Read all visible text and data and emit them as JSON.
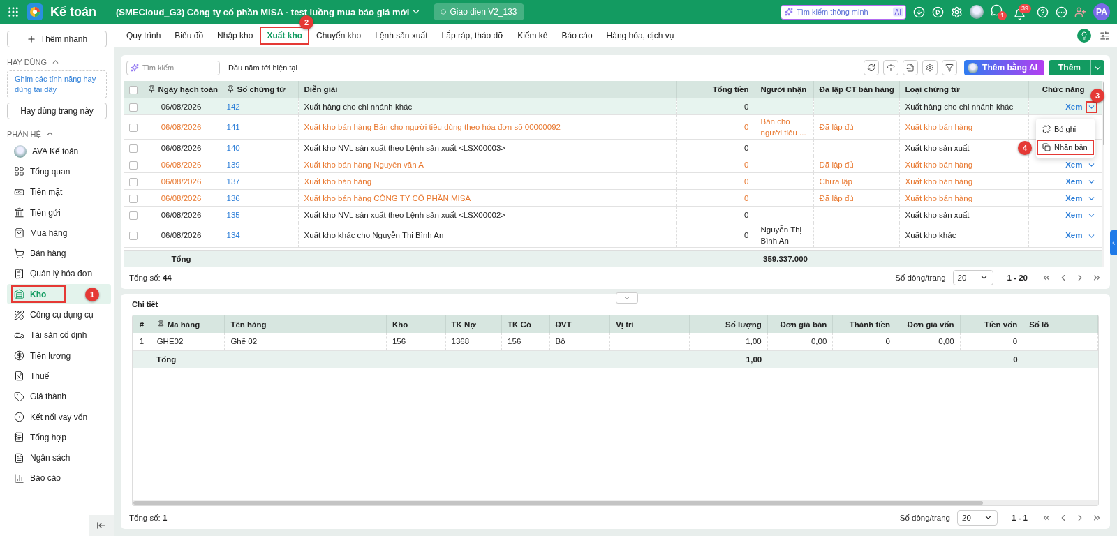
{
  "topbar": {
    "app_name": "Kế toán",
    "company": "(SMECloud_G3) Công ty cổ phần MISA - test luồng mua báo giá mới",
    "version": "Giao dien V2_133",
    "search": {
      "placeholder": "Tìm kiếm thông minh",
      "badge": "AI"
    },
    "chat_count": "1",
    "notification_count": "39",
    "avatar_initials": "PA"
  },
  "sidebar": {
    "quick_add": "Thêm nhanh",
    "favorites": {
      "title": "HAY DÙNG",
      "expanded": true,
      "hint": "Ghim các tính năng hay dùng tại đây",
      "pin_button": "Hay dùng trang này"
    },
    "modules": {
      "title": "PHÂN HỆ",
      "expanded": true,
      "items": [
        {
          "label": "AVA Kế toán",
          "selected": false
        },
        {
          "label": "Tổng quan",
          "selected": false
        },
        {
          "label": "Tiền mặt",
          "selected": false
        },
        {
          "label": "Tiền gửi",
          "selected": false
        },
        {
          "label": "Mua hàng",
          "selected": false
        },
        {
          "label": "Bán hàng",
          "selected": false
        },
        {
          "label": "Quản lý hóa đơn",
          "selected": false
        },
        {
          "label": "Kho",
          "selected": true,
          "callout": "1"
        },
        {
          "label": "Công cụ dụng cụ",
          "selected": false
        },
        {
          "label": "Tài sản cố định",
          "selected": false
        },
        {
          "label": "Tiền lương",
          "selected": false
        },
        {
          "label": "Thuế",
          "selected": false
        },
        {
          "label": "Giá thành",
          "selected": false
        },
        {
          "label": "Kết nối vay vốn",
          "selected": false
        },
        {
          "label": "Tổng hợp",
          "selected": false
        },
        {
          "label": "Ngân sách",
          "selected": false
        },
        {
          "label": "Báo cáo",
          "selected": false
        }
      ]
    }
  },
  "tabs": [
    {
      "label": "Quy trình",
      "selected": false
    },
    {
      "label": "Biểu đồ",
      "selected": false
    },
    {
      "label": "Nhập kho",
      "selected": false
    },
    {
      "label": "Xuất kho",
      "selected": true,
      "callout": "2"
    },
    {
      "label": "Chuyển kho",
      "selected": false
    },
    {
      "label": "Lệnh sản xuất",
      "selected": false
    },
    {
      "label": "Lắp ráp, tháo dỡ",
      "selected": false
    },
    {
      "label": "Kiểm kê",
      "selected": false
    },
    {
      "label": "Báo cáo",
      "selected": false
    },
    {
      "label": "Hàng hóa, dịch vụ",
      "selected": false
    }
  ],
  "toolbar": {
    "search": {
      "placeholder": "Tìm kiếm"
    },
    "period": "Đầu năm tới hiện tại",
    "ai_button": "Thêm bằng AI",
    "add_button": "Thêm"
  },
  "table": {
    "all_checked": false,
    "columns": [
      "Ngày hạch toán",
      "Số chứng từ",
      "Diễn giải",
      "Tổng tiền",
      "Người nhận",
      "Đã lập CT bán hàng",
      "Loại chứng từ",
      "Chức năng"
    ],
    "rows": [
      {
        "date": "06/08/2026",
        "number": "142",
        "description": "Xuất hàng cho chi nhánh khác",
        "total": "0",
        "receiver": "",
        "sales_doc": "",
        "doc_type": "Xuất hàng cho chi nhánh khác",
        "view": "Xem",
        "highlighted": false,
        "selected": true,
        "checked": false,
        "caret_callout": "3"
      },
      {
        "date": "06/08/2026",
        "number": "141",
        "description": "Xuất kho bán hàng Bán cho người tiêu dùng theo hóa đơn số 00000092",
        "total": "0",
        "receiver": "Bán cho người tiêu ...",
        "sales_doc": "Đã lập đủ",
        "doc_type": "Xuất kho bán hàng",
        "highlighted": true,
        "selected": false,
        "checked": false
      },
      {
        "date": "06/08/2026",
        "number": "140",
        "description": "Xuất kho NVL sản xuất theo Lệnh sản xuất <LSX00003>",
        "total": "0",
        "receiver": "",
        "sales_doc": "",
        "doc_type": "Xuất kho sản xuất",
        "highlighted": false,
        "selected": false,
        "checked": false
      },
      {
        "date": "06/08/2026",
        "number": "139",
        "description": "Xuất kho bán hàng Nguyễn văn A",
        "total": "0",
        "receiver": "",
        "sales_doc": "Đã lập đủ",
        "doc_type": "Xuất kho bán hàng",
        "view": "Xem",
        "highlighted": true,
        "selected": false,
        "checked": false
      },
      {
        "date": "06/08/2026",
        "number": "137",
        "description": "Xuất kho bán hàng",
        "total": "0",
        "receiver": "",
        "sales_doc": "Chưa lập",
        "doc_type": "Xuất kho bán hàng",
        "view": "Xem",
        "highlighted": true,
        "selected": false,
        "checked": false
      },
      {
        "date": "06/08/2026",
        "number": "136",
        "description": "Xuất kho bán hàng CÔNG TY CỔ PHẦN MISA",
        "total": "0",
        "receiver": "",
        "sales_doc": "Đã lập đủ",
        "doc_type": "Xuất kho bán hàng",
        "view": "Xem",
        "highlighted": true,
        "selected": false,
        "checked": false
      },
      {
        "date": "06/08/2026",
        "number": "135",
        "description": "Xuất kho NVL sản xuất theo Lệnh sản xuất <LSX00002>",
        "total": "0",
        "receiver": "",
        "sales_doc": "",
        "doc_type": "Xuất kho sản xuất",
        "view": "Xem",
        "highlighted": false,
        "selected": false,
        "checked": false
      },
      {
        "date": "06/08/2026",
        "number": "134",
        "description": "Xuất kho khác cho Nguyễn Thị Bình An",
        "total": "0",
        "receiver": "Nguyễn Thị Bình An",
        "sales_doc": "",
        "doc_type": "Xuất kho khác",
        "view": "Xem",
        "highlighted": false,
        "selected": false,
        "checked": false
      }
    ],
    "total_label": "Tổng",
    "total_amount": "359.337.000",
    "count": "Tổng số: **44**",
    "pager": {
      "label": "Số dòng/trang",
      "page_size": "20",
      "range": "1 - 20"
    }
  },
  "row_menu": [
    {
      "label": "Bỏ ghi"
    },
    {
      "label": "Nhân bản",
      "callout": "4"
    }
  ],
  "detail": {
    "title": "Chi tiết",
    "columns": [
      "#",
      "Mã hàng",
      "Tên hàng",
      "Kho",
      "TK Nợ",
      "TK Có",
      "ĐVT",
      "Vị trí",
      "Số lượng",
      "Đơn giá bán",
      "Thành tiền",
      "Đơn giá vốn",
      "Tiền vốn",
      "Số lô"
    ],
    "rows": [
      [
        "1",
        "GHE02",
        "Ghế 02",
        "156",
        "1368",
        "156",
        "Bộ",
        "",
        "1,00",
        "0,00",
        "0",
        "0,00",
        "0",
        ""
      ]
    ],
    "totals": {
      "label": "Tổng",
      "quantity": "1,00",
      "cost": "0"
    },
    "count": "Tổng số: **1**",
    "pager": {
      "label": "Số dòng/trang",
      "page_size": "20",
      "range": "1 - 1"
    }
  }
}
